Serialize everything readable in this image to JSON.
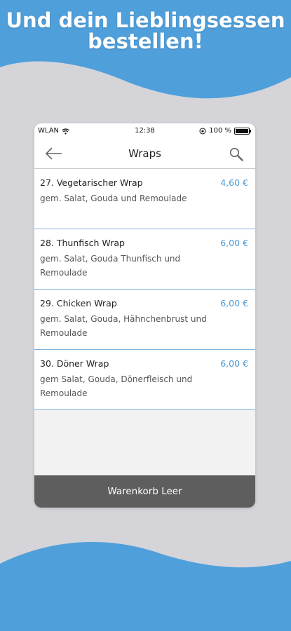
{
  "headline": {
    "line1": "Und dein Lieblingsessen",
    "line2": "bestellen!"
  },
  "colors": {
    "accent_blue": "#4a9ad6",
    "wave_blue": "#4f9fdb",
    "background_gray": "#d4d4d9",
    "cart_bar": "#5e5e5e"
  },
  "status_bar": {
    "carrier": "WLAN",
    "time": "12:38",
    "battery": "100 %",
    "battery_level": 1.0
  },
  "nav": {
    "title": "Wraps",
    "back_icon": "arrow-left-icon",
    "search_icon": "search-icon"
  },
  "items": [
    {
      "name": "27. Vegetarischer Wrap",
      "price": "4,60 €",
      "desc": "gem. Salat, Gouda und Remoulade"
    },
    {
      "name": "28. Thunfisch Wrap",
      "price": "6,00 €",
      "desc": "gem. Salat, Gouda Thunfisch und Remoulade"
    },
    {
      "name": "29. Chicken Wrap",
      "price": "6,00 €",
      "desc": "gem. Salat, Gouda, Hähnchenbrust und Remoulade"
    },
    {
      "name": "30. Döner Wrap",
      "price": "6,00 €",
      "desc": "gem Salat, Gouda, Dönerfleisch und Remoulade"
    }
  ],
  "cart": {
    "label": "Warenkorb Leer"
  }
}
